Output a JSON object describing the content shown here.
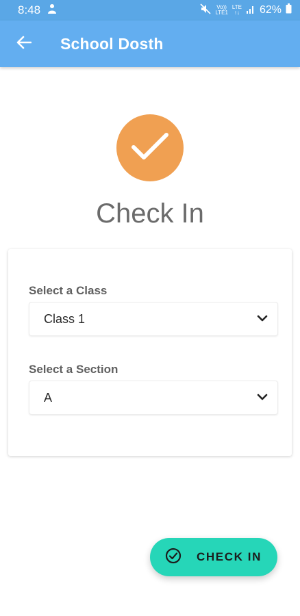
{
  "status_bar": {
    "time": "8:48",
    "network_top": "Vo))",
    "network_bottom": "LTE1",
    "lte_top": "LTE",
    "lte_bottom": "↑↓",
    "battery": "62%"
  },
  "app_bar": {
    "title": "School Dosth",
    "back_icon": "arrow-left-icon"
  },
  "hero": {
    "icon": "check-icon",
    "icon_color": "#f0a052",
    "heading": "Check In"
  },
  "form": {
    "class_label": "Select a Class",
    "class_value": "Class 1",
    "section_label": "Select a Section",
    "section_value": "A"
  },
  "fab": {
    "label": "CHECK IN",
    "icon": "check-circle-icon",
    "color": "#26d6b8"
  },
  "colors": {
    "app_bar": "#63aef0",
    "status_bar": "#5aa7e6"
  }
}
